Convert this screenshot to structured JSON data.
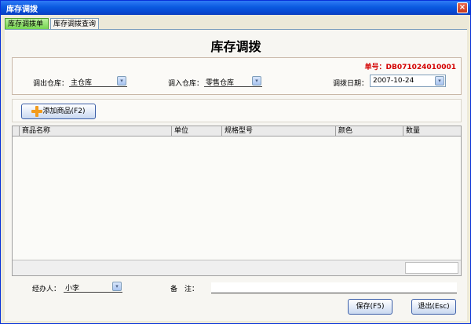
{
  "window": {
    "title": "库存调拨",
    "close_glyph": "×"
  },
  "tabs": [
    {
      "label": "库存调拨单",
      "active": true
    },
    {
      "label": "库存调拨查询",
      "active": false
    }
  ],
  "form": {
    "heading": "库存调拨",
    "order_no": "单号：DB071024010001",
    "out_warehouse": {
      "label": "调出仓库：",
      "value": "主仓库"
    },
    "in_warehouse": {
      "label": "调入仓库：",
      "value": "零售仓库"
    },
    "date": {
      "label": "调拨日期：",
      "value": "2007-10-24"
    },
    "dropdown_glyph": "▾"
  },
  "toolbar": {
    "add_label": "添加商品(F2)",
    "add_icon": "plus-icon"
  },
  "table": {
    "columns": [
      "商品名称",
      "单位",
      "规格型号",
      "颜色",
      "数量"
    ],
    "rows": []
  },
  "footer": {
    "handler": {
      "label": "经办人：",
      "value": "小李"
    },
    "note_label": "备　注：",
    "save_label": "保存(F5)",
    "exit_label": "退出(Esc)"
  },
  "colors": {
    "title_bar": "#0a5ae0",
    "order_no": "#d40000",
    "active_tab": "#6fd34a"
  }
}
